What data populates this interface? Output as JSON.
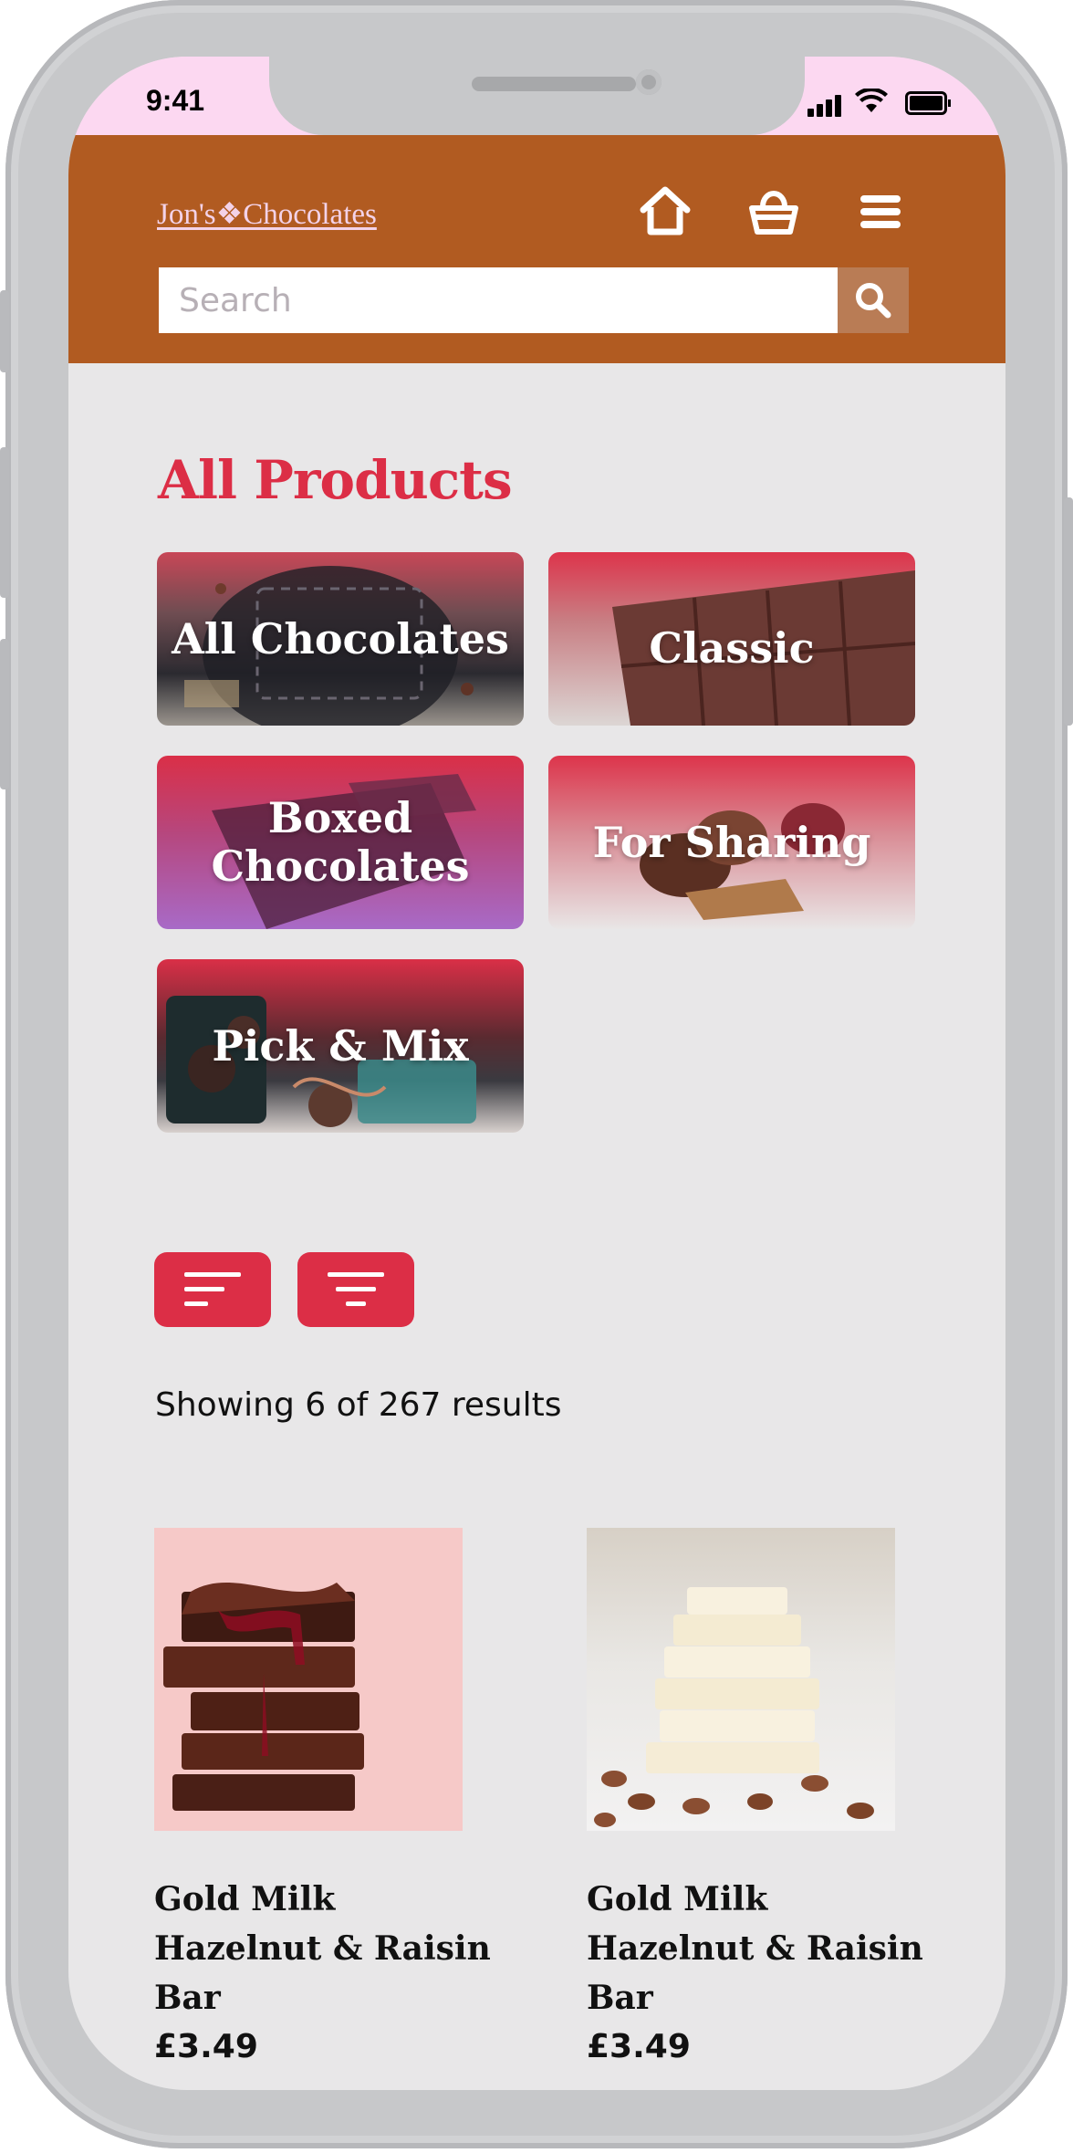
{
  "status_bar": {
    "time": "9:41"
  },
  "header": {
    "logo": "Jon's❖Chocolates",
    "home_label": "home",
    "basket_label": "basket",
    "menu_label": "menu",
    "search": {
      "placeholder": "Search",
      "value": ""
    },
    "bg_color": "#b15b21"
  },
  "main": {
    "title": "All Products",
    "categories": [
      {
        "label": "All Chocolates"
      },
      {
        "label": "Classic"
      },
      {
        "label": "Boxed Chocolates"
      },
      {
        "label": "For Sharing"
      },
      {
        "label": "Pick & Mix"
      }
    ],
    "results_text": "Showing 6 of 267 results",
    "products": [
      {
        "name": "Gold Milk Hazelnut & Raisin Bar",
        "price": "£3.49",
        "image": "stacked-dark-chocolate-with-raspberry"
      },
      {
        "name": "Gold Milk Hazelnut & Raisin Bar",
        "price": "£3.49",
        "image": "stacked-white-chocolate-with-almonds"
      }
    ],
    "accent_color": "#dc2e46"
  }
}
